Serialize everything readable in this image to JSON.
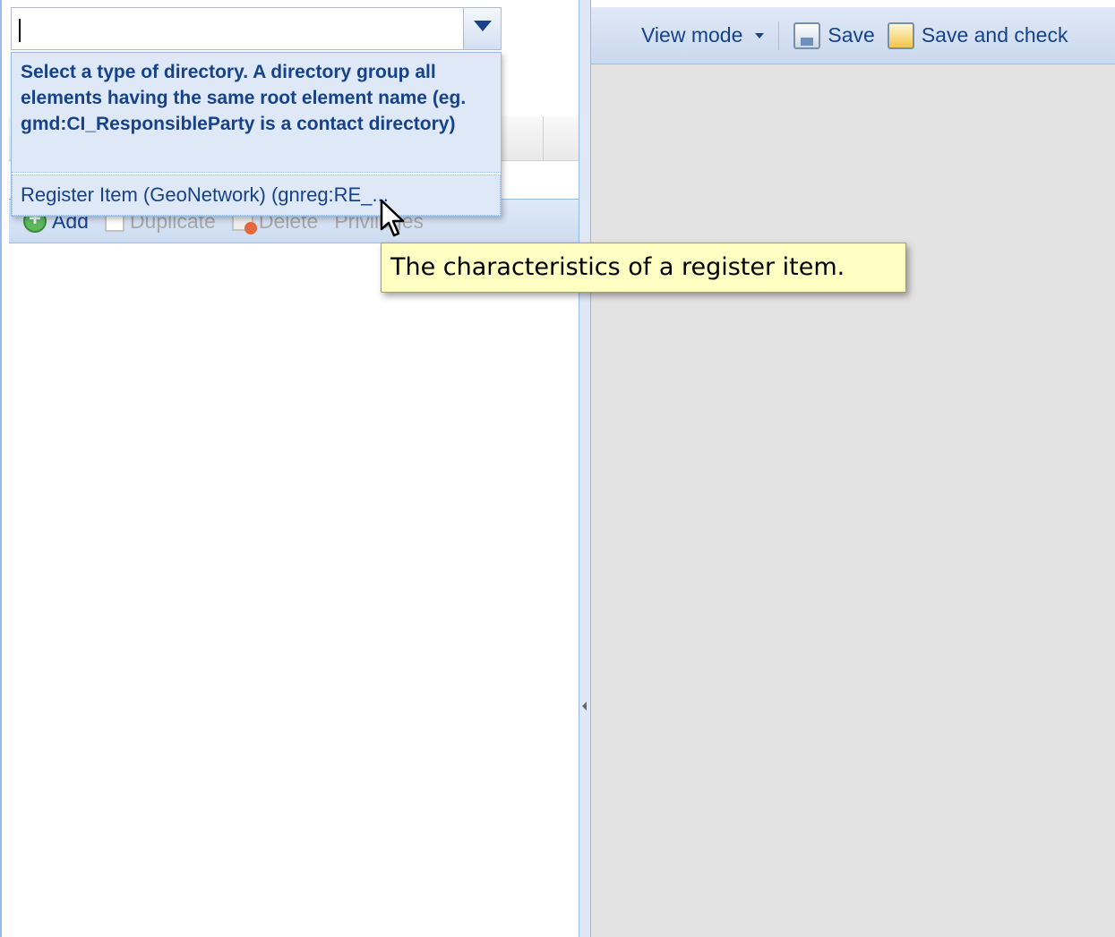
{
  "combo": {
    "value": "",
    "dropdown_description": "Select a type of directory. A directory group all elements having the same root element name (eg. gmd:CI_ResponsibleParty is a contact directory)",
    "options": [
      {
        "label": "Register Item (GeoNetwork) (gnreg:RE_..."
      }
    ]
  },
  "left_toolbar": {
    "add_label": "Add",
    "duplicate_label": "Duplicate",
    "delete_label": "Delete",
    "privileges_label": "Privileges"
  },
  "right_toolbar": {
    "view_mode_label": "View mode",
    "save_label": "Save",
    "save_and_check_label": "Save and check"
  },
  "tooltip": {
    "text": "The characteristics of a register item."
  },
  "icons": {
    "add": "add-icon",
    "duplicate": "duplicate-icon",
    "delete": "delete-icon",
    "save": "save-icon",
    "save_and_check": "save-check-icon",
    "dropdown": "chevron-down-icon",
    "collapse": "collapse-left-icon"
  },
  "colors": {
    "accent": "#15428b",
    "panel_border": "#99bbe8",
    "selection": "#dfe8f6",
    "tooltip_bg": "#ffffc4",
    "disabled_text": "#a7a7a7"
  }
}
